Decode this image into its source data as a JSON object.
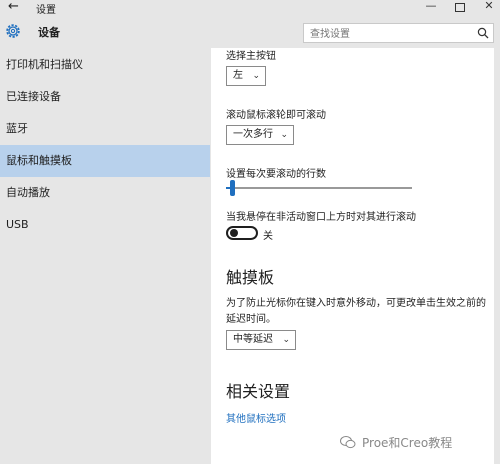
{
  "window": {
    "back_glyph": "←",
    "title": "设置",
    "min_glyph": "—",
    "close_glyph": "✕"
  },
  "sidebar": {
    "header_title": "设备",
    "items": [
      {
        "label": "打印机和扫描仪"
      },
      {
        "label": "已连接设备"
      },
      {
        "label": "蓝牙"
      },
      {
        "label": "鼠标和触摸板",
        "selected": true
      },
      {
        "label": "自动播放"
      },
      {
        "label": "USB"
      }
    ]
  },
  "search": {
    "placeholder": "查找设置",
    "icon": "search-icon"
  },
  "mouse": {
    "primary_button_label": "选择主按钮",
    "primary_button_value": "左",
    "scroll_label": "滚动鼠标滚轮即可滚动",
    "scroll_value": "一次多行",
    "lines_label": "设置每次要滚动的行数",
    "lines_slider_fraction": 0.03,
    "inactive_scroll_label": "当我悬停在非活动窗口上方时对其进行滚动",
    "inactive_scroll_state": "关"
  },
  "touchpad": {
    "heading": "触摸板",
    "description": "为了防止光标你在键入时意外移动，可更改单击生效之前的延迟时间。",
    "delay_value": "中等延迟"
  },
  "related": {
    "heading": "相关设置",
    "link": "其他鼠标选项"
  },
  "watermark": {
    "text": "Proe和Creo教程"
  },
  "colors": {
    "accent": "#1f6fbf",
    "selected_bg": "#b8d1ec"
  }
}
